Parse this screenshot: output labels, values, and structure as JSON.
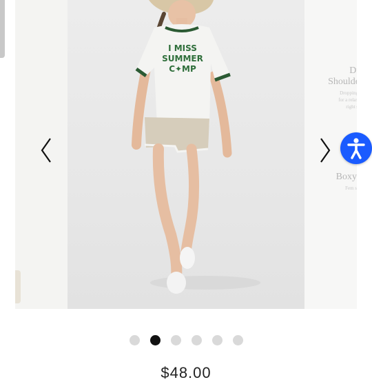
{
  "product_image": {
    "shirt_lines": [
      "I MISS",
      "SUMMER",
      "C✦MP"
    ]
  },
  "side_panel": {
    "heading_1": "Dr",
    "heading_1b": "Shoulde",
    "small_1": "Dropping",
    "small_2": "for a relax",
    "small_3": "right s",
    "heading_2": "Boxy",
    "small_4": "Fem s"
  },
  "carousel": {
    "prev_icon": "chevron-left-icon",
    "next_icon": "chevron-right-icon",
    "dots_total": 6,
    "active_index": 1
  },
  "accessibility": {
    "icon": "accessibility-person-icon",
    "color": "#1a5bff"
  },
  "price": {
    "text": "$48.00"
  },
  "colors": {
    "shirt_trim": "#2b5a33",
    "shorts": "#d6cdbb",
    "background": "#e9e9e9"
  }
}
